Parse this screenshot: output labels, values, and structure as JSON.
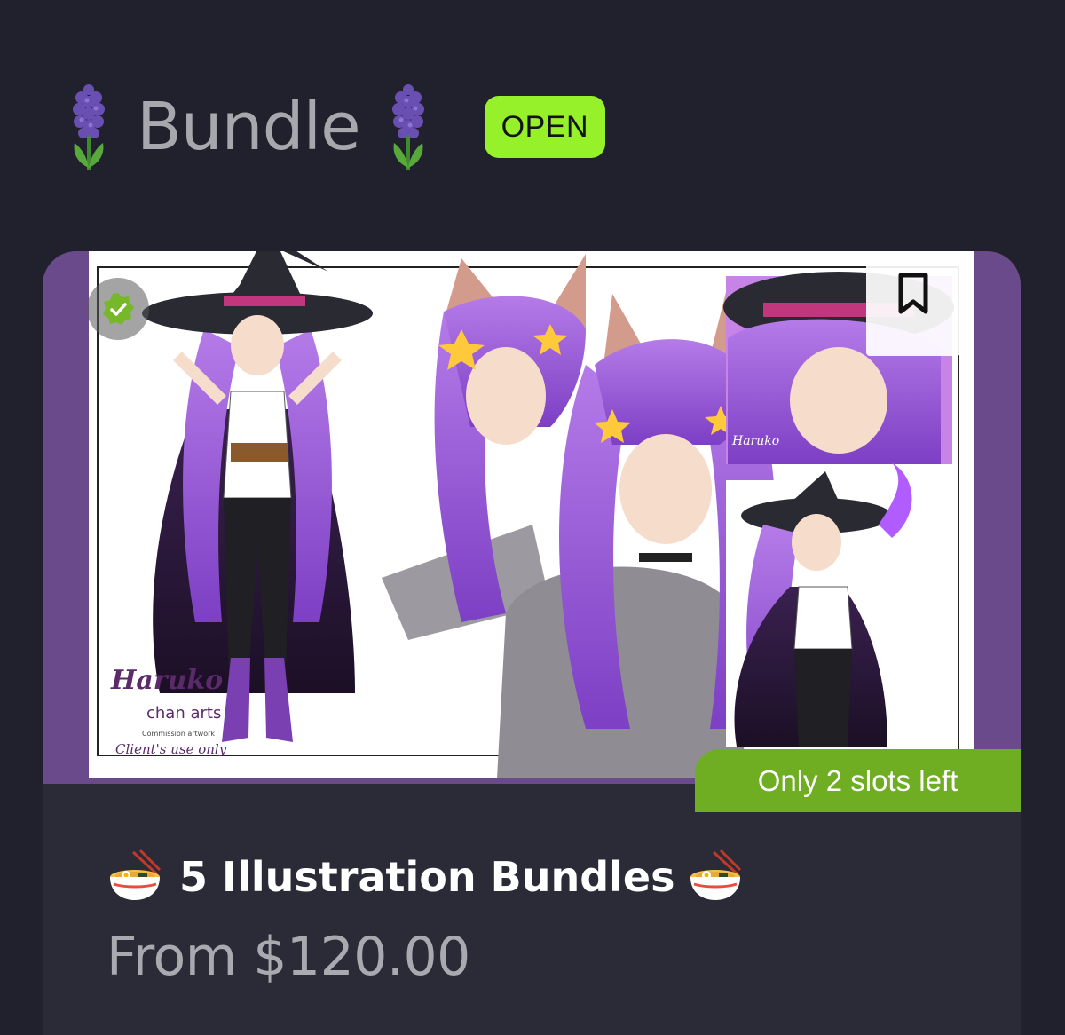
{
  "section": {
    "title": "Bundle",
    "status": "OPEN",
    "title_icon": "hyacinth-icon",
    "status_color": "#96f02a"
  },
  "card": {
    "banner": "Only 2 slots left",
    "title": "5 Illustration Bundles",
    "title_icon": "ramen-bowl-icon",
    "price": "From $120.00",
    "bookmark_icon": "bookmark-icon",
    "verified_icon": "check-badge-icon",
    "banner_color": "#6fad22",
    "image_background": "#6a4a8a",
    "artwork_watermark": [
      "Haruko",
      "chan arts",
      "Commission artwork",
      "Client's use only"
    ]
  }
}
